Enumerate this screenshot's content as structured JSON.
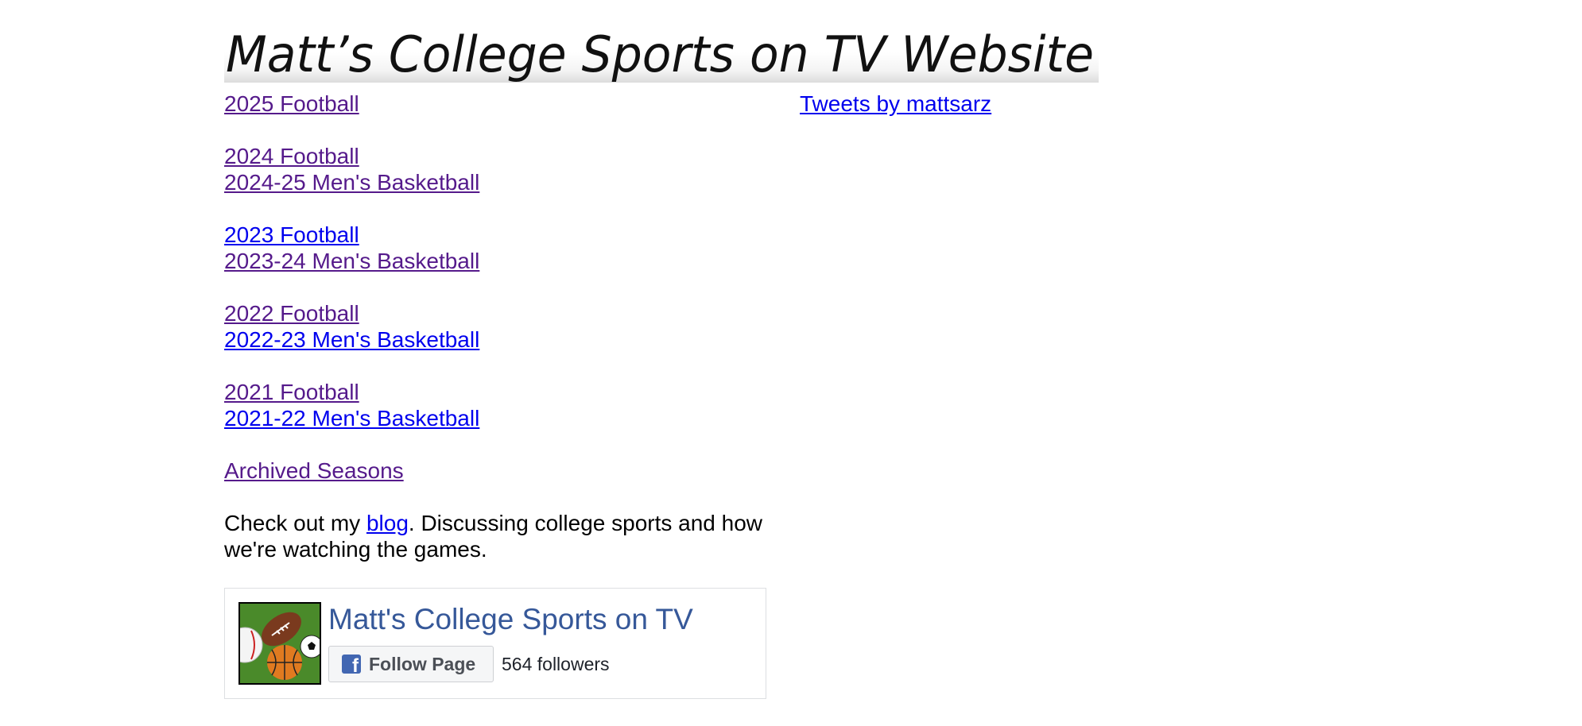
{
  "banner": {
    "title": "Matt’s College Sports on TV Website"
  },
  "nav": {
    "groups": [
      {
        "links": [
          {
            "label": "2025 Football",
            "visited": true
          }
        ]
      },
      {
        "links": [
          {
            "label": "2024 Football",
            "visited": true
          },
          {
            "label": "2024-25 Men's Basketball",
            "visited": true
          }
        ]
      },
      {
        "links": [
          {
            "label": "2023 Football",
            "visited": false
          },
          {
            "label": "2023-24 Men's Basketball",
            "visited": true
          }
        ]
      },
      {
        "links": [
          {
            "label": "2022 Football",
            "visited": true
          },
          {
            "label": "2022-23 Men's Basketball",
            "visited": false
          }
        ]
      },
      {
        "links": [
          {
            "label": "2021 Football",
            "visited": true
          },
          {
            "label": "2021-22 Men's Basketball",
            "visited": false
          }
        ]
      },
      {
        "links": [
          {
            "label": "Archived Seasons",
            "visited": true
          }
        ]
      }
    ]
  },
  "blog": {
    "prefix": "Check out my ",
    "link_label": "blog",
    "suffix": ". Discussing college sports and how we're watching the games."
  },
  "twitter": {
    "link_label": "Tweets by mattsarz"
  },
  "facebook": {
    "page_name": "Matt's College Sports on TV",
    "follow_label": "Follow Page",
    "followers": "564 followers",
    "avatar_icon": "sports-balls-icon"
  },
  "colors": {
    "visited_link": "#551A8B",
    "unvisited_link": "#0000EE",
    "fb_blue": "#365899",
    "fb_icon_blue": "#4267b2"
  }
}
